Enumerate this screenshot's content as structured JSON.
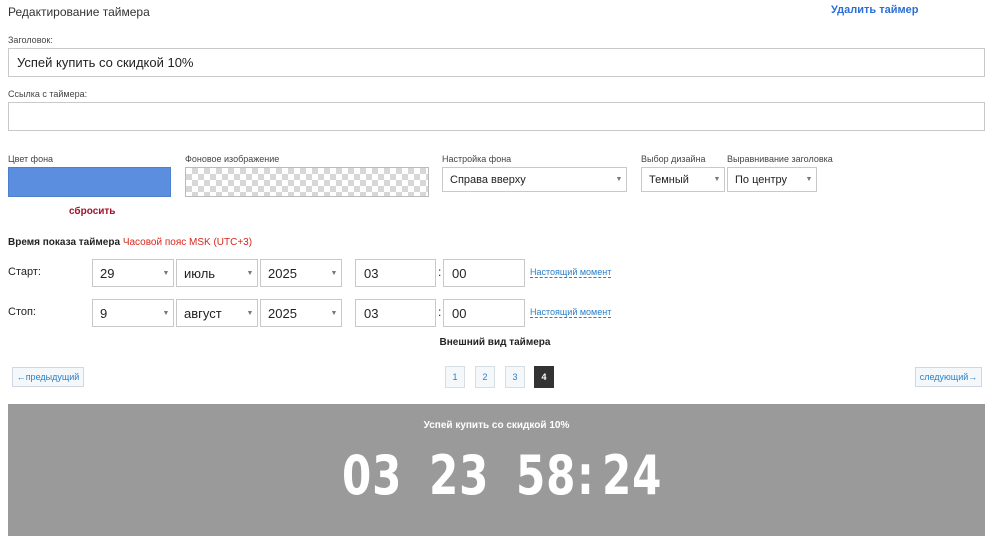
{
  "header": {
    "title": "Редактирование таймера",
    "delete_label": "Удалить таймер"
  },
  "form": {
    "heading_label": "Заголовок:",
    "heading_value": "Успей купить со скидкой 10%",
    "link_label": "Ссылка с таймера:",
    "link_value": "",
    "bg_color_label": "Цвет фона",
    "bg_color": "#5b8ede",
    "reset_label": "сбросить",
    "bg_image_label": "Фоновое изображение",
    "bg_settings_label": "Настройка фона",
    "bg_settings_value": "Справа вверху",
    "design_label": "Выбор дизайна",
    "design_value": "Темный",
    "align_label": "Выравнивание заголовка",
    "align_value": "По центру"
  },
  "schedule": {
    "title": "Время показа таймера",
    "timezone": "Часовой пояс MSK (UTC+3)",
    "start": {
      "label": "Старт:",
      "day": "29",
      "month": "июль",
      "year": "2025",
      "hour": "03",
      "minute": "00",
      "now_label": "Настоящий момент"
    },
    "stop": {
      "label": "Стоп:",
      "day": "9",
      "month": "август",
      "year": "2025",
      "hour": "03",
      "minute": "00",
      "now_label": "Настоящий момент"
    },
    "colon": ":"
  },
  "appearance": {
    "title": "Внешний вид таймера",
    "prev_label": "←предыдущий",
    "next_label": "следующий→",
    "pages": [
      "1",
      "2",
      "3",
      "4"
    ],
    "active_page": "4"
  },
  "preview": {
    "heading": "Успей купить со скидкой 10%",
    "days": "03",
    "hours": "23",
    "minutes": "58",
    "separator": ":",
    "seconds": "24",
    "background": "#9a9a9a"
  }
}
